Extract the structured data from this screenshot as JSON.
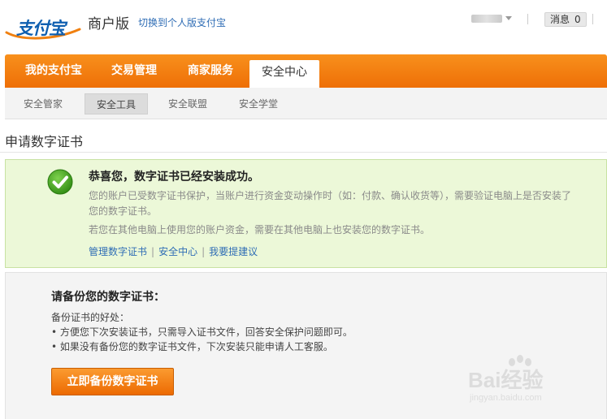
{
  "header": {
    "logo_text": "支付宝",
    "merchant_label": "商户版",
    "switch_link": "切换到个人版支付宝",
    "messages_label": "消息",
    "messages_count": "0"
  },
  "main_nav": {
    "tabs": [
      {
        "label": "我的支付宝",
        "active": false
      },
      {
        "label": "交易管理",
        "active": false
      },
      {
        "label": "商家服务",
        "active": false
      },
      {
        "label": "安全中心",
        "active": true
      }
    ]
  },
  "sub_nav": {
    "items": [
      {
        "label": "安全管家",
        "active": false
      },
      {
        "label": "安全工具",
        "active": true
      },
      {
        "label": "安全联盟",
        "active": false
      },
      {
        "label": "安全学堂",
        "active": false
      }
    ]
  },
  "page_title": "申请数字证书",
  "success": {
    "title": "恭喜您，数字证书已经安装成功。",
    "desc1": "您的账户已受数字证书保护，当账户进行资金变动操作时（如：付款、确认收货等），需要验证电脑上是否安装了您的数字证书。",
    "desc2": "若您在其他电脑上使用您的账户资金，需要在其他电脑上也安装您的数字证书。",
    "links": [
      "管理数字证书",
      "安全中心",
      "我要提建议"
    ],
    "separator": "|"
  },
  "backup": {
    "title": "请备份您的数字证书：",
    "benefits_heading": "备份证书的好处：",
    "benefits": [
      "• 方便您下次安装证书，只需导入证书文件，回答安全保护问题即可。",
      "• 如果没有备份您的数字证书文件，下次安装只能申请人工客服。"
    ],
    "button_label": "立即备份数字证书"
  },
  "watermark": {
    "text": "Bai经验",
    "url": "jingyan.baidu.com"
  },
  "colors": {
    "accent": "#f08010",
    "link": "#2f6db5",
    "success_bg": "#ecf8d8",
    "check_green": "#3c9a1c"
  }
}
